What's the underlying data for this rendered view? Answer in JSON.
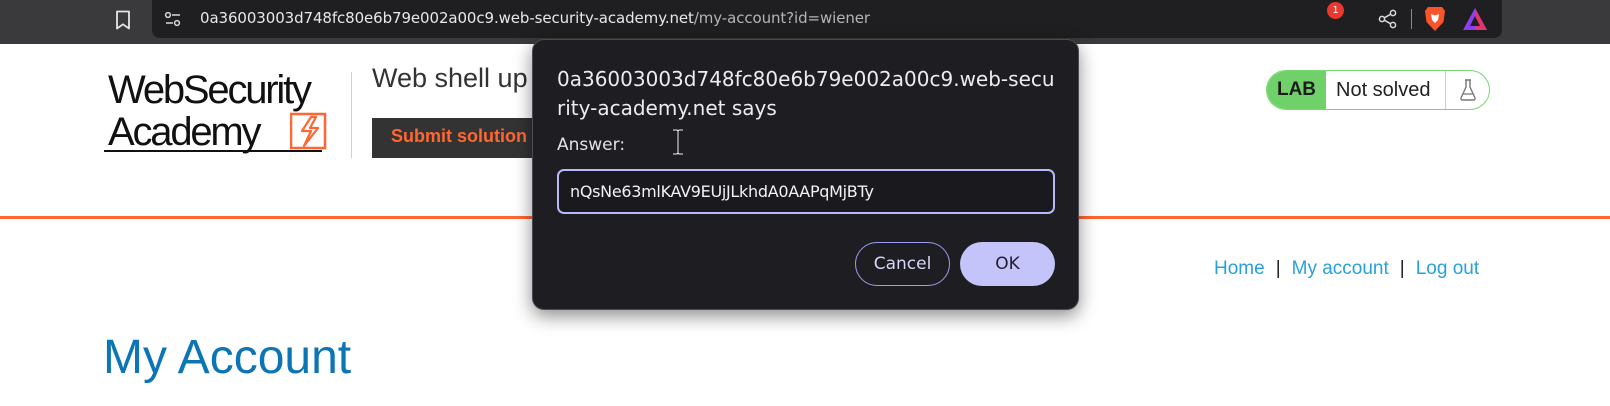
{
  "browser": {
    "url_host": "0a36003003d748fc80e6b79e002a00c9.web-security-academy.net",
    "url_path": "/my-account?id=wiener",
    "rewards_badge_count": "1",
    "icons": [
      "bookmark-icon",
      "site-info-icon",
      "share-icon",
      "brave-shield-icon",
      "brave-rewards-icon"
    ]
  },
  "header": {
    "logo_line1": "WebSecurity",
    "logo_line2": "Academy",
    "lab_title": "Web shell up",
    "submit_label": "Submit solution",
    "lab_badge": "LAB",
    "lab_status": "Not solved",
    "accent_color": "#ff6633"
  },
  "nav": {
    "items": [
      {
        "label": "Home"
      },
      {
        "label": "My account"
      },
      {
        "label": "Log out"
      }
    ],
    "separator": "|"
  },
  "main": {
    "title": "My Account"
  },
  "dialog": {
    "title": "0a36003003d748fc80e6b79e002a00c9.web-security-academy.net says",
    "label": "Answer:",
    "input_value": "nQsNe63mlKAV9EUjJLkhdA0AAPqMjBTy",
    "cancel_label": "Cancel",
    "ok_label": "OK"
  }
}
